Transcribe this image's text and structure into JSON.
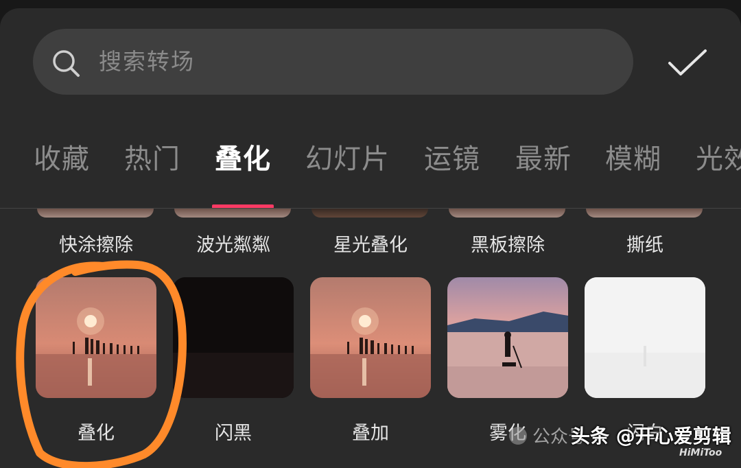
{
  "search": {
    "placeholder": "搜索转场",
    "icon": "search-icon"
  },
  "confirm": {
    "icon": "checkmark-icon"
  },
  "tabs": [
    {
      "label": "收藏",
      "active": false
    },
    {
      "label": "热门",
      "active": false
    },
    {
      "label": "叠化",
      "active": true
    },
    {
      "label": "幻灯片",
      "active": false
    },
    {
      "label": "运镜",
      "active": false
    },
    {
      "label": "最新",
      "active": false
    },
    {
      "label": "模糊",
      "active": false
    },
    {
      "label": "光效",
      "active": false
    }
  ],
  "row1_labels": [
    "快涂擦除",
    "波光粼粼",
    "星光叠化",
    "黑板擦除",
    "撕纸"
  ],
  "row2_items": [
    {
      "label": "叠化",
      "selected": true
    },
    {
      "label": "闪黑",
      "selected": false
    },
    {
      "label": "叠加",
      "selected": false
    },
    {
      "label": "雾化",
      "selected": false
    },
    {
      "label": "闪白",
      "selected": false
    }
  ],
  "colors": {
    "accent": "#ff3a64",
    "annotation": "#ff8a2a",
    "background": "#2a2a2a"
  },
  "watermark": {
    "gzh_text": "公众号",
    "toutiao_text": "头条 @开心爱剪辑",
    "latin_text": "HiMiToo"
  }
}
